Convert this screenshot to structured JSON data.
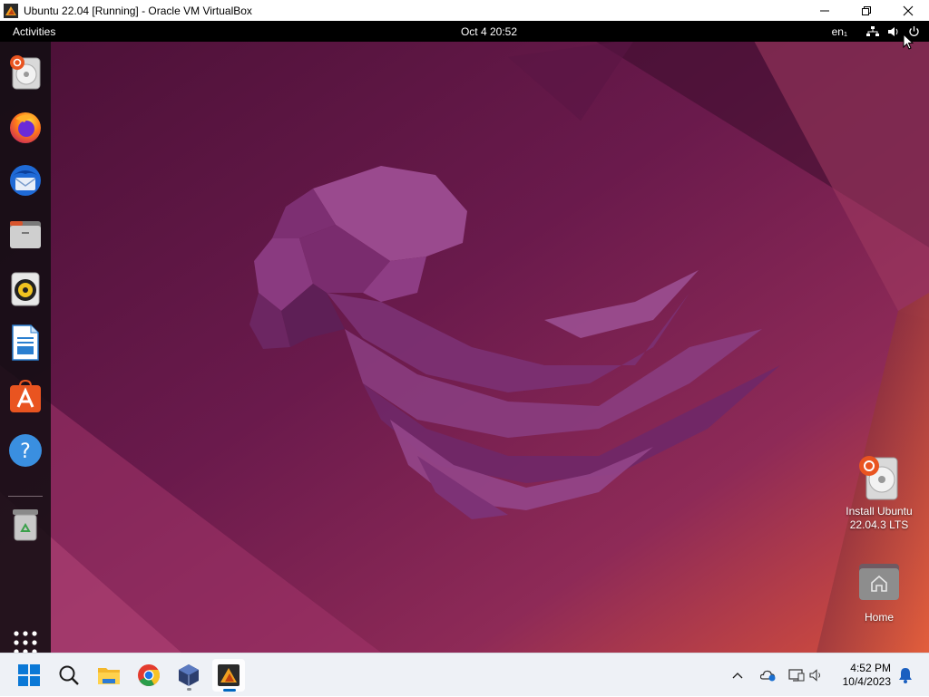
{
  "window": {
    "title": "Ubuntu 22.04 [Running] - Oracle VM VirtualBox",
    "controls": [
      "minimize",
      "maximize",
      "close"
    ]
  },
  "ubuntu": {
    "topbar": {
      "activities": "Activities",
      "clock": "Oct 4  20:52",
      "language": "en₁",
      "tray_icons": [
        "network-icon",
        "volume-icon",
        "power-icon"
      ]
    },
    "dock": {
      "items": [
        {
          "name": "install-ubuntu",
          "icon": "installer-disc-icon"
        },
        {
          "name": "firefox",
          "icon": "firefox-icon"
        },
        {
          "name": "thunderbird",
          "icon": "thunderbird-icon"
        },
        {
          "name": "files",
          "icon": "files-icon"
        },
        {
          "name": "rhythmbox",
          "icon": "rhythmbox-icon"
        },
        {
          "name": "libreoffice-writer",
          "icon": "writer-icon"
        },
        {
          "name": "ubuntu-software",
          "icon": "software-icon"
        },
        {
          "name": "help",
          "icon": "help-icon"
        },
        {
          "name": "trash",
          "icon": "trash-icon"
        },
        {
          "name": "show-applications",
          "icon": "app-grid-icon"
        }
      ]
    },
    "desktop_icons": [
      {
        "label_line1": "Install Ubuntu",
        "label_line2": "22.04.3 LTS",
        "icon": "installer-disc-icon"
      },
      {
        "label_line1": "Home",
        "label_line2": "",
        "icon": "home-folder-icon"
      }
    ],
    "colors": {
      "wallpaper_dark": "#3c0f2b",
      "wallpaper_mid": "#7a1f55",
      "wallpaper_orange": "#e0553a",
      "jellyfish": "#8a3a7a"
    }
  },
  "taskbar": {
    "pinned": [
      "start-icon",
      "search-icon",
      "file-explorer-icon",
      "chrome-icon",
      "virtualbox-icon",
      "vm-window-icon"
    ],
    "tray_icons": [
      "chevron-up-icon",
      "onedrive-icon",
      "network-icon",
      "volume-icon"
    ],
    "time": "4:52 PM",
    "date": "10/4/2023",
    "notification_icon": "bell-icon"
  }
}
